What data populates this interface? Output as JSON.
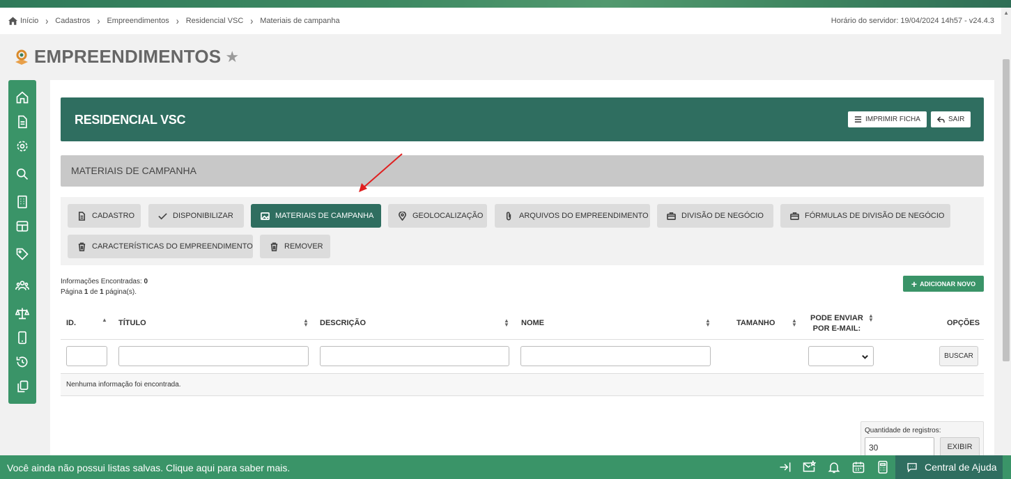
{
  "breadcrumb": {
    "items": [
      "Início",
      "Cadastros",
      "Empreendimentos",
      "Residencial VSC",
      "Materiais de campanha"
    ],
    "server_time": "Horário do servidor: 19/04/2024 14h57 - v24.4.3"
  },
  "page": {
    "title": "EMPREENDIMENTOS"
  },
  "sidenav": {
    "items": [
      "home-icon",
      "document-icon",
      "gear-icon",
      "search-icon",
      "building-icon",
      "table-icon",
      "tag-icon",
      "users-icon",
      "scale-icon",
      "mobile-icon",
      "history-icon",
      "copy-icon"
    ]
  },
  "header": {
    "title": "RESIDENCIAL VSC",
    "print_label": "IMPRIMIR FICHA",
    "exit_label": "SAIR"
  },
  "section": {
    "title": "MATERIAIS DE CAMPANHA"
  },
  "tabs": [
    {
      "label": "CADASTRO",
      "icon": "file-icon",
      "active": false
    },
    {
      "label": "DISPONIBILIZAR",
      "icon": "check-icon",
      "active": false
    },
    {
      "label": "MATERIAIS DE CAMPANHA",
      "icon": "image-icon",
      "active": true
    },
    {
      "label": "GEOLOCALIZAÇÃO",
      "icon": "pin-icon",
      "active": false
    },
    {
      "label": "ARQUIVOS DO EMPREENDIMENTO",
      "icon": "paperclip-icon",
      "active": false
    },
    {
      "label": "DIVISÃO DE NEGÓCIO",
      "icon": "briefcase-icon",
      "active": false
    },
    {
      "label": "FÓRMULAS DE DIVISÃO DE NEGÓCIO",
      "icon": "briefcase-icon",
      "active": false
    },
    {
      "label": "CARACTERÍSTICAS DO EMPREENDIMENTO",
      "icon": "trash-icon",
      "active": false
    },
    {
      "label": "REMOVER",
      "icon": "trash-icon",
      "active": false
    }
  ],
  "results": {
    "found_label": "Informações Encontradas:",
    "found_count": "0",
    "page_prefix": "Página",
    "page_current": "1",
    "page_of": "de",
    "page_total": "1",
    "page_suffix": "página(s)."
  },
  "add_button": {
    "label": "ADICIONAR NOVO"
  },
  "table": {
    "headers": [
      "ID.",
      "TÍTULO",
      "DESCRIÇÃO",
      "NOME",
      "TAMANHO",
      "PODE ENVIAR POR E-MAIL:",
      "OPÇÕES"
    ],
    "header_email_line1": "PODE ENVIAR",
    "header_email_line2": "POR E-MAIL:",
    "search_label": "BUSCAR",
    "empty_message": "Nenhuma informação foi encontrada."
  },
  "quantity": {
    "label": "Quantidade de registros:",
    "value": "30",
    "button": "EXIBIR"
  },
  "footer": {
    "message": "Você ainda não possui listas salvas. Clique aqui para saber mais.",
    "help_label": "Central de Ajuda"
  },
  "colors": {
    "primary": "#2f6e60",
    "accent": "#3a9468",
    "annotation": "#e02020"
  }
}
